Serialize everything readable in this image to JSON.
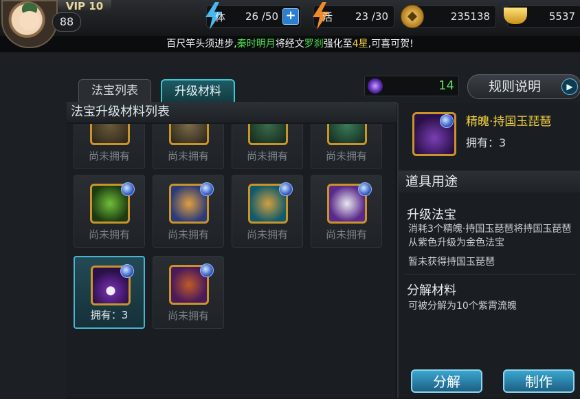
{
  "header": {
    "vip": "VIP 10",
    "level": "88",
    "stamina": {
      "label": "体",
      "value": "26 /50",
      "plus": "+"
    },
    "vitality": {
      "label": "活",
      "value": "23 /30"
    },
    "coins": "235138",
    "ingots": "5537"
  },
  "ticker": {
    "part1": "百尺竿头须进步,",
    "player": "秦时明月",
    "part2": "将经文",
    "item": "罗刹",
    "part3": "强化至",
    "stars": "4星",
    "part4": ",可喜可贺!"
  },
  "tabs": [
    {
      "label": "法宝列表"
    },
    {
      "label": "升级材料"
    }
  ],
  "counter": "14",
  "rules_button": "规则说明",
  "list_title": "法宝升级材料列表",
  "grid": {
    "rows": [
      [
        {
          "label": "尚未拥有"
        },
        {
          "label": "尚未拥有"
        },
        {
          "label": "尚未拥有"
        },
        {
          "label": "尚未拥有"
        }
      ],
      [
        {
          "label": "尚未拥有"
        },
        {
          "label": "尚未拥有"
        },
        {
          "label": "尚未拥有"
        },
        {
          "label": "尚未拥有"
        }
      ],
      [
        {
          "label": "拥有：3"
        },
        {
          "label": "尚未拥有"
        }
      ]
    ]
  },
  "detail": {
    "name": "精魄·持国玉琵琶",
    "owned": "拥有：3",
    "usage_title": "道具用途",
    "upgrade_title": "升级法宝",
    "upgrade_desc": "消耗3个精魄·持国玉琵琶将持国玉琵琶从紫色升级为金色法宝",
    "upgrade_note": "暂未获得持国玉琵琶",
    "decompose_title": "分解材料",
    "decompose_desc": "可被分解为10个紫霄流魄"
  },
  "buttons": {
    "decompose": "分解",
    "craft": "制作"
  }
}
